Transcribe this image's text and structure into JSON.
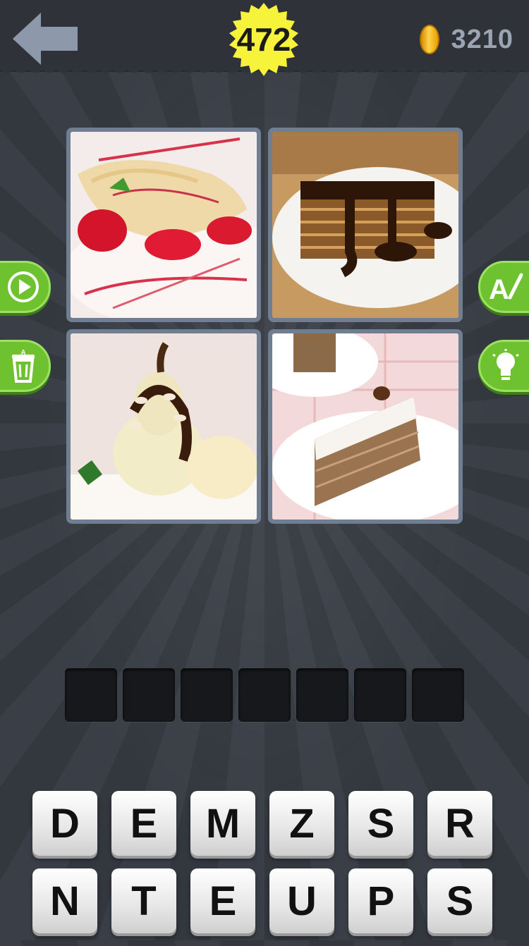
{
  "header": {
    "level": "472",
    "coins": "3210"
  },
  "icons": {
    "back": "back-arrow-icon",
    "coin": "coin-icon",
    "play": "play-video-icon",
    "remove_letters": "trash-icon",
    "reveal_letter": "reveal-letter-icon",
    "hint": "lightbulb-icon"
  },
  "pictures": [
    {
      "subject": "strawberry crepes"
    },
    {
      "subject": "chocolate layer cake slice"
    },
    {
      "subject": "poached pear with chocolate"
    },
    {
      "subject": "layered cream cake slice"
    }
  ],
  "answer": {
    "length": 7,
    "slots": [
      "",
      "",
      "",
      "",
      "",
      "",
      ""
    ]
  },
  "keyboard": {
    "row1": [
      "D",
      "E",
      "M",
      "Z",
      "S",
      "R"
    ],
    "row2": [
      "N",
      "T",
      "E",
      "U",
      "P",
      "S"
    ]
  },
  "colors": {
    "badge": "#f7f23a",
    "button_green": "#6ec22f",
    "background": "#363a41"
  }
}
